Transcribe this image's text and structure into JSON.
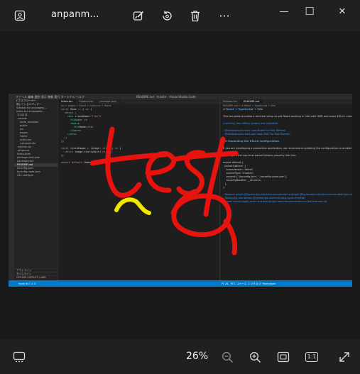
{
  "window": {
    "title": "anpanm...",
    "buttons": {
      "minimize": "—",
      "maximize": "☐",
      "close": "✕"
    }
  },
  "toolbar_top": {
    "icons": [
      "gallery-icon",
      "edit-image-icon",
      "rotate-icon",
      "delete-icon",
      "more-icon"
    ],
    "more_label": "···"
  },
  "screenshot": {
    "window_title": "README.md - tcsvite - Visual Studio Code",
    "menu": [
      "ファイル",
      "編集",
      "選択",
      "表示",
      "移動",
      "実行",
      "ターミナル",
      "ヘルプ"
    ],
    "sidebar": {
      "header": "エクスプローラー",
      "rows": [
        "開いているエディター",
        "Sidebar.tsx  src/pages/...",
        "index.tsx  src/pages/...",
        "TCSVITE",
        ".vscode",
        "node_modules",
        "public",
        "src",
        "pages",
        "Home",
        "index.tsx",
        "components",
        ".eslintrc.cjs",
        ".gitignore",
        "index.html",
        "package-lock.json",
        "package.json",
        "README.md",
        "tsconfig.json",
        "tsconfig.node.json",
        "vite.config.ts"
      ],
      "bottom": [
        "アウトライン",
        "タイムライン",
        "GITHUB COPILOT: LABS"
      ]
    },
    "editor_left": {
      "tabs": [
        "index.tsx",
        "Sidebar.tsx",
        "package.json"
      ],
      "breadcrumb": "src > pages > Home > index.tsx > Home",
      "lines": [
        "const Home = () => {",
        "  return (",
        "    <div className=\"flex\">",
        "      <Sidebar />",
        "      <main>",
        "        <h1>Home</h1>",
        "      </main>",
        "    </div>",
        "  );",
        "};",
        "",
        "const checkImage = (image: string) => {",
        "  return image.startsWith('http')",
        "};",
        "",
        "export default Home"
      ]
    },
    "editor_right": {
      "tabs": [
        "Sidebar.tsx",
        "README.md"
      ],
      "breadcrumb": "README.md > # React + TypeScript + Vite",
      "lines": [
        "# React + TypeScript + Vite",
        "",
        "This template provides a minimal setup to get React working in Vite with HMR and some ESLint rules.",
        "",
        "Currently, two official plugins are available:",
        "",
        "- @vitejs/plugin-react uses Babel for Fast Refresh",
        "- @vitejs/plugin-react-swc uses SWC for Fast Refresh",
        "",
        "## Expanding the ESLint configuration",
        "",
        "If you are developing a production application, we recommend updating the configuration to enable type aware lint rules:",
        "",
        "- Configure the top-level parserOptions property like this:",
        "",
        "export default {",
        "  parserOptions: {",
        "    ecmaVersion: 'latest',",
        "    sourceType: 'module',",
        "    project: ['./tsconfig.json', './tsconfig.node.json'],",
        "    tsconfigRootDir: __dirname,",
        "  },",
        "}",
        "",
        "- Replace plugin:@typescript-eslint/recommended to plugin:@typescript-eslint/recommended-type-checked",
        "- Optionally add plugin:@typescript-eslint/stylistic-type-checked",
        "- Install eslint-plugin-react and add plugin:react/recommended to the extends list"
      ]
    },
    "status_bar": {
      "left": "main  ⊗ 0 ⚠ 0",
      "right": "行 28、列 1   スペース: 2   UTF-8   LF   Markdown"
    },
    "scribble_text": "test",
    "scribble_color": "#e8130f",
    "highlight_color": "#f5e600"
  },
  "toolbar_bottom": {
    "zoom_level": "26%",
    "icons": [
      "filmstrip-icon",
      "zoom-out-icon",
      "zoom-in-icon",
      "fit-to-window-icon",
      "actual-size-icon",
      "fullscreen-icon"
    ],
    "actual_size_label": "1:1"
  }
}
